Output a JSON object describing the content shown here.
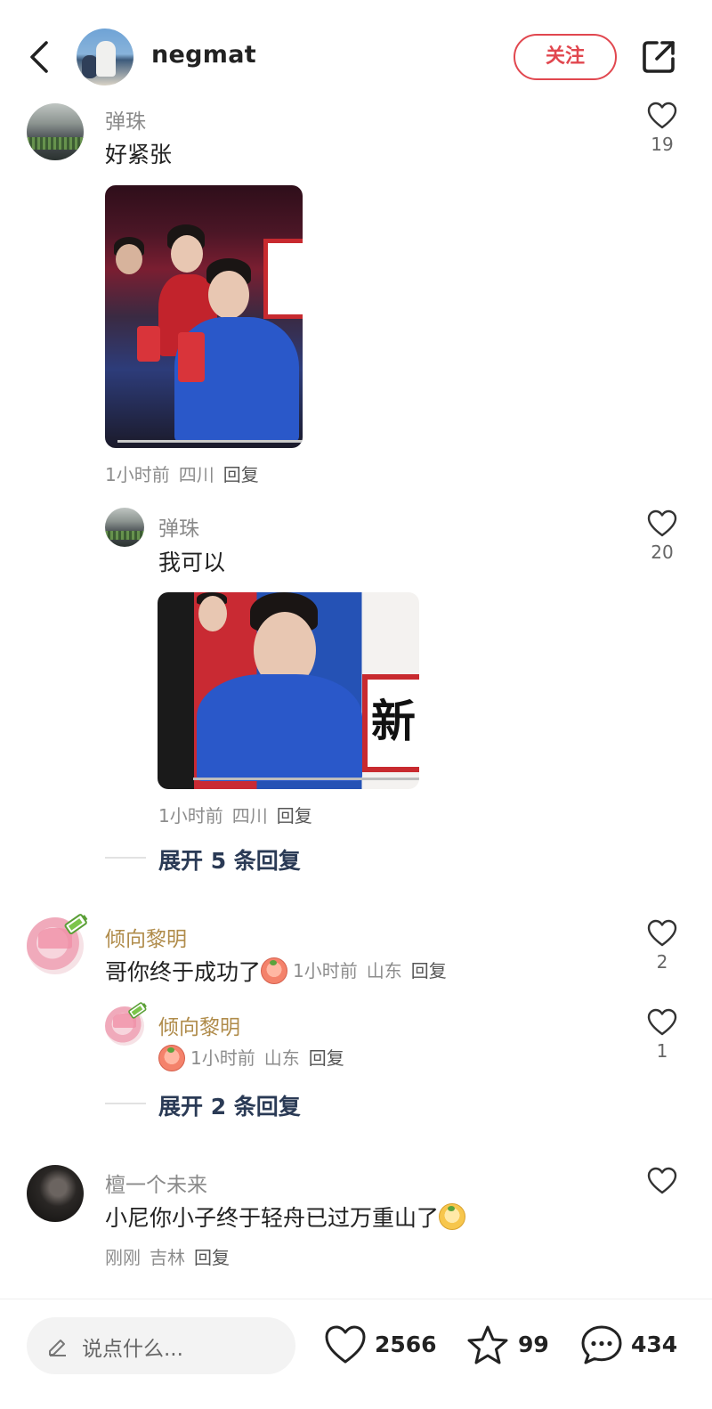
{
  "header": {
    "author_name": "negmat",
    "follow_label": "关注"
  },
  "comments": [
    {
      "username": "弹珠",
      "text": "好紧张",
      "likes": "19",
      "time": "1小时前",
      "location": "四川",
      "reply_label": "回复",
      "image": {
        "cup_text": ""
      },
      "replies": [
        {
          "username": "弹珠",
          "text": "我可以",
          "likes": "20",
          "time": "1小时前",
          "location": "四川",
          "reply_label": "回复",
          "image": {
            "sign_text": "新"
          }
        }
      ],
      "expand_label": "展开 5 条回复"
    },
    {
      "username": "倾向黎明",
      "text": "哥你终于成功了",
      "likes": "2",
      "time": "1小时前",
      "location": "山东",
      "reply_label": "回复",
      "replies": [
        {
          "username": "倾向黎明",
          "likes": "1",
          "time": "1小时前",
          "location": "山东",
          "reply_label": "回复"
        }
      ],
      "expand_label": "展开 2 条回复"
    },
    {
      "username": "檀一个未来",
      "text": "小尼你小子终于轻舟已过万重山了",
      "time": "刚刚",
      "location": "吉林",
      "reply_label": "回复"
    }
  ],
  "bottom_bar": {
    "input_placeholder": "说点什么...",
    "like_count": "2566",
    "collect_count": "99",
    "comment_count": "434"
  },
  "colors": {
    "accent_red": "#e1474f",
    "username_gray": "#8a8a8a",
    "username_gold": "#b08c4b",
    "expand_text": "#2a3a55"
  },
  "icons": [
    "back-arrow-icon",
    "share-icon",
    "heart-icon",
    "star-icon",
    "comment-bubble-icon",
    "pen-icon",
    "battery-badge-icon",
    "emoji-icon"
  ]
}
